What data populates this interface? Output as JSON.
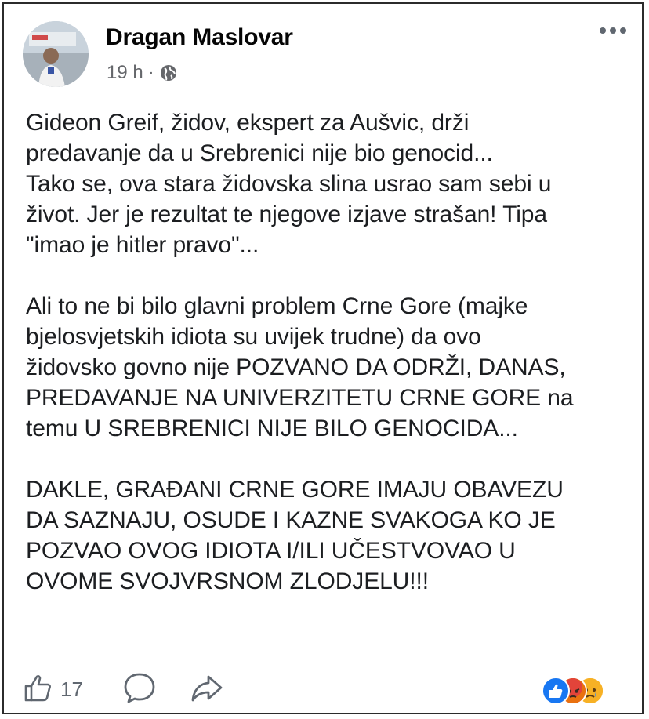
{
  "post": {
    "author": "Dragan Maslovar",
    "time": "19 h",
    "separator": "·",
    "privacy_icon": "globe-icon",
    "more_icon": "more-dots-icon",
    "paragraphs": [
      [
        "Gideon Greif, židov, ekspert za Aušvic, drži",
        "predavanje da u Srebrenici nije bio genocid...",
        "Tako se, ova stara židovska slina usrao sam sebi u",
        "život. Jer je rezultat te njegove izjave strašan! Tipa",
        "\"imao je hitler pravo\"..."
      ],
      [
        "Ali to ne bi bilo glavni problem Crne Gore (majke",
        "bjelosvjetskih idiota su uvijek trudne) da ovo",
        "židovsko govno nije POZVANO DA ODRŽI, DANAS,",
        "PREDAVANJE NA UNIVERZITETU CRNE GORE na",
        "temu U SREBRENICI NIJE BILO GENOCIDA..."
      ],
      [
        "DAKLE, GRAĐANI CRNE GORE IMAJU OBAVEZU",
        "DA SAZNAJU, OSUDE I KAZNE SVAKOGA KO JE",
        "POZVAO OVOG IDIOTA I/ILI UČESTVOVAO U",
        "OVOME SVOJVRSNOM ZLODJELU!!!"
      ]
    ]
  },
  "actions": {
    "like_count": "17",
    "like_icon": "thumbs-up-icon",
    "comment_icon": "comment-icon",
    "share_icon": "share-icon"
  },
  "reactions": [
    "like",
    "angry",
    "sad"
  ],
  "colors": {
    "author": "#050505",
    "meta": "#65676b",
    "text": "#1c1e21",
    "icon": "#606770",
    "like_blue": "#1877f2",
    "angry_red": "#e9710f",
    "sad_yellow": "#f7b125"
  }
}
